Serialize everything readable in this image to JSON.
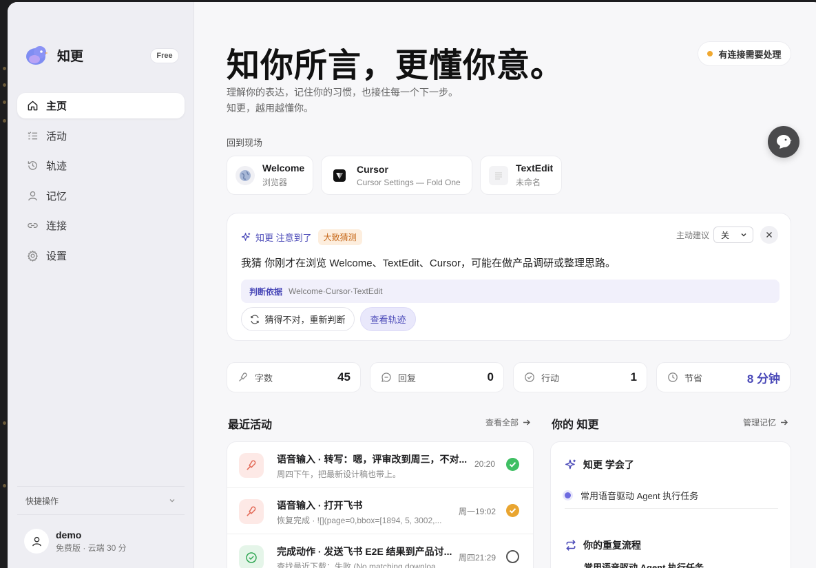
{
  "app": {
    "name": "知更",
    "plan_badge": "Free"
  },
  "nav": [
    {
      "id": "home",
      "label": "主页",
      "active": true,
      "icon": "home-icon"
    },
    {
      "id": "activity",
      "label": "活动",
      "icon": "list-icon"
    },
    {
      "id": "trace",
      "label": "轨迹",
      "icon": "history-icon"
    },
    {
      "id": "memory",
      "label": "记忆",
      "icon": "person-icon"
    },
    {
      "id": "connect",
      "label": "连接",
      "icon": "link-icon"
    },
    {
      "id": "settings",
      "label": "设置",
      "icon": "gear-icon"
    }
  ],
  "quick_actions": {
    "label": "快捷操作"
  },
  "user": {
    "name": "demo",
    "plan": "免费版 · 云端 30 分"
  },
  "hero": {
    "title": "知你所言，更懂你意。",
    "subtitle_line1": "理解你的表达，记住你的习惯，也接住每一个下一步。",
    "subtitle_line2": "知更，越用越懂你。"
  },
  "alert": {
    "label": "有连接需要处理",
    "color": "#f0a830"
  },
  "scenes": {
    "label": "回到现场",
    "items": [
      {
        "name": "Welcome",
        "sub": "浏览器",
        "icon": "globe-icon"
      },
      {
        "name": "Cursor",
        "sub": "Cursor Settings — Fold One",
        "icon": "cursor-app-icon"
      },
      {
        "name": "TextEdit",
        "sub": "未命名",
        "icon": "textedit-icon"
      }
    ]
  },
  "insight": {
    "title": "知更 注意到了",
    "tag": "大致猜测",
    "proactive_label": "主动建议",
    "proactive_value": "关",
    "text": "我猜 你刚才在浏览 Welcome、TextEdit、Cursor，可能在做产品调研或整理思路。",
    "basis_label": "判断依据",
    "basis_value": "Welcome·Cursor·TextEdit",
    "regen_label": "猜得不对，重新判断",
    "trace_label": "查看轨迹"
  },
  "stats": [
    {
      "label": "字数",
      "value": "45",
      "icon": "mic-icon"
    },
    {
      "label": "回复",
      "value": "0",
      "icon": "chat-icon"
    },
    {
      "label": "行动",
      "value": "1",
      "icon": "check-circle-icon"
    },
    {
      "label": "节省",
      "value": "8 分钟",
      "icon": "clock-icon",
      "accent": true
    }
  ],
  "recent": {
    "title": "最近活动",
    "link": "查看全部",
    "items": [
      {
        "title": "语音输入 · 转写：嗯，评审改到周三，不对...",
        "sub": "周四下午，把最新设计稿也带上。",
        "time": "20:20",
        "status": "success",
        "icon": "mic-icon"
      },
      {
        "title": "语音输入 · 打开飞书",
        "sub": "恢复完成 · ![](page=0,bbox=[1894, 5, 3002,...",
        "time": "周一19:02",
        "status": "warning",
        "icon": "mic-icon"
      },
      {
        "title": "完成动作 · 发送飞书 E2E 结果到产品讨...",
        "sub": "查找最近下载：失败 (No matching downloa...",
        "time": "周四21:29",
        "status": "pending",
        "icon": "check-circle-icon"
      }
    ]
  },
  "memory": {
    "title": "你的 知更",
    "link": "管理记忆",
    "learned_title": "知更 学会了",
    "learned_item": "常用语音驱动 Agent 执行任务",
    "flows_title": "你的重复流程",
    "flows_item": "常用语音驱动 Agent 执行任务"
  },
  "colors": {
    "accent": "#4a49b8",
    "success": "#3fbf63",
    "warning": "#e9a530"
  }
}
